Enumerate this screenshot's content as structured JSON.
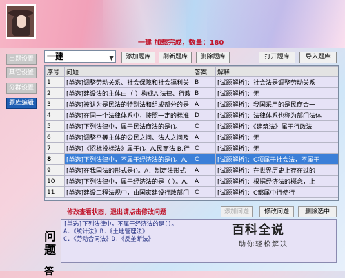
{
  "header": {
    "status": "一建 加载完成，数量：180"
  },
  "sidebar": {
    "items": [
      {
        "label": "出题设置",
        "active": false
      },
      {
        "label": "其它设置",
        "active": false
      },
      {
        "label": "分群设置",
        "active": false
      },
      {
        "label": "题库编辑",
        "active": true
      }
    ]
  },
  "toolbar": {
    "bank_select": "一建",
    "add_bank": "添加题库",
    "refresh_bank": "刷新题库",
    "delete_bank": "删除题库",
    "open_bank": "打开题库",
    "import_bank": "导入题库"
  },
  "table": {
    "headers": [
      "序号",
      "问题",
      "答案",
      "解释"
    ],
    "rows": [
      {
        "num": "1",
        "q": "[单选]调整劳动关系、社会保障和社会福利关",
        "a": "B",
        "e": "[试题解析]：社会法是调整劳动关系"
      },
      {
        "num": "2",
        "q": "[单选]建设法的主体由（ ）构成A.法律、行政",
        "a": "B",
        "e": "[试题解析]：无"
      },
      {
        "num": "3",
        "q": "[单选]被认为是民法的特别法和组成部分的是",
        "a": "A",
        "e": "[试题解析]：我国采用的是民商合一"
      },
      {
        "num": "4",
        "q": "[单选]在同一个法律体系中，按照一定的标准",
        "a": "D",
        "e": "[试题解析]：法律体系也称为部门法体"
      },
      {
        "num": "5",
        "q": "[单选]下列法律中，属于民法商法的是()。",
        "a": "C",
        "e": "[试题解析]：《建筑法》属于行政法"
      },
      {
        "num": "6",
        "q": "[单选]调整平等主体的公民之间、法人之间及",
        "a": "A",
        "e": "[试题解析]：无"
      },
      {
        "num": "7",
        "q": "[单选]《招标投标法》属于()。A.民商法 B.行",
        "a": "C",
        "e": "[试题解析]：无"
      },
      {
        "num": "8",
        "q": "[单选]下列法律中，不属于经济法的是()。A.",
        "a": "C",
        "e": "[试题解析]：C项属于社会法，不属于",
        "selected": true
      },
      {
        "num": "9",
        "q": "[单选]在我国法的形式是()。A．制定法形式",
        "a": "A",
        "e": "[试题解析]：在世界历史上存在过的"
      },
      {
        "num": "10",
        "q": "[单选]下列法律中，属于经济法的是（ ）。A.",
        "a": "A",
        "e": "[试题解析]：根据经济法的概念，上"
      },
      {
        "num": "11",
        "q": "[单选]建设工程法规中，由国家建设行政部门",
        "a": "C",
        "e": "[试题解析]：C都属中行使行"
      }
    ]
  },
  "hint": "修改查看状态，退出请点击修改问题",
  "actions": {
    "add_question": "添加问题",
    "edit_question": "修改问题",
    "delete_selected": "删除选中"
  },
  "question": {
    "label": "问题",
    "text_lines": [
      "[单选]下列法律中，不属于经济法的是()。",
      "A.《统计法》B.《土地管理法》",
      "C.《劳动合同法》D.《反垄断法》"
    ],
    "label2": "答"
  },
  "watermark": {
    "title": "百科全说",
    "subtitle": "助你轻松解决"
  }
}
